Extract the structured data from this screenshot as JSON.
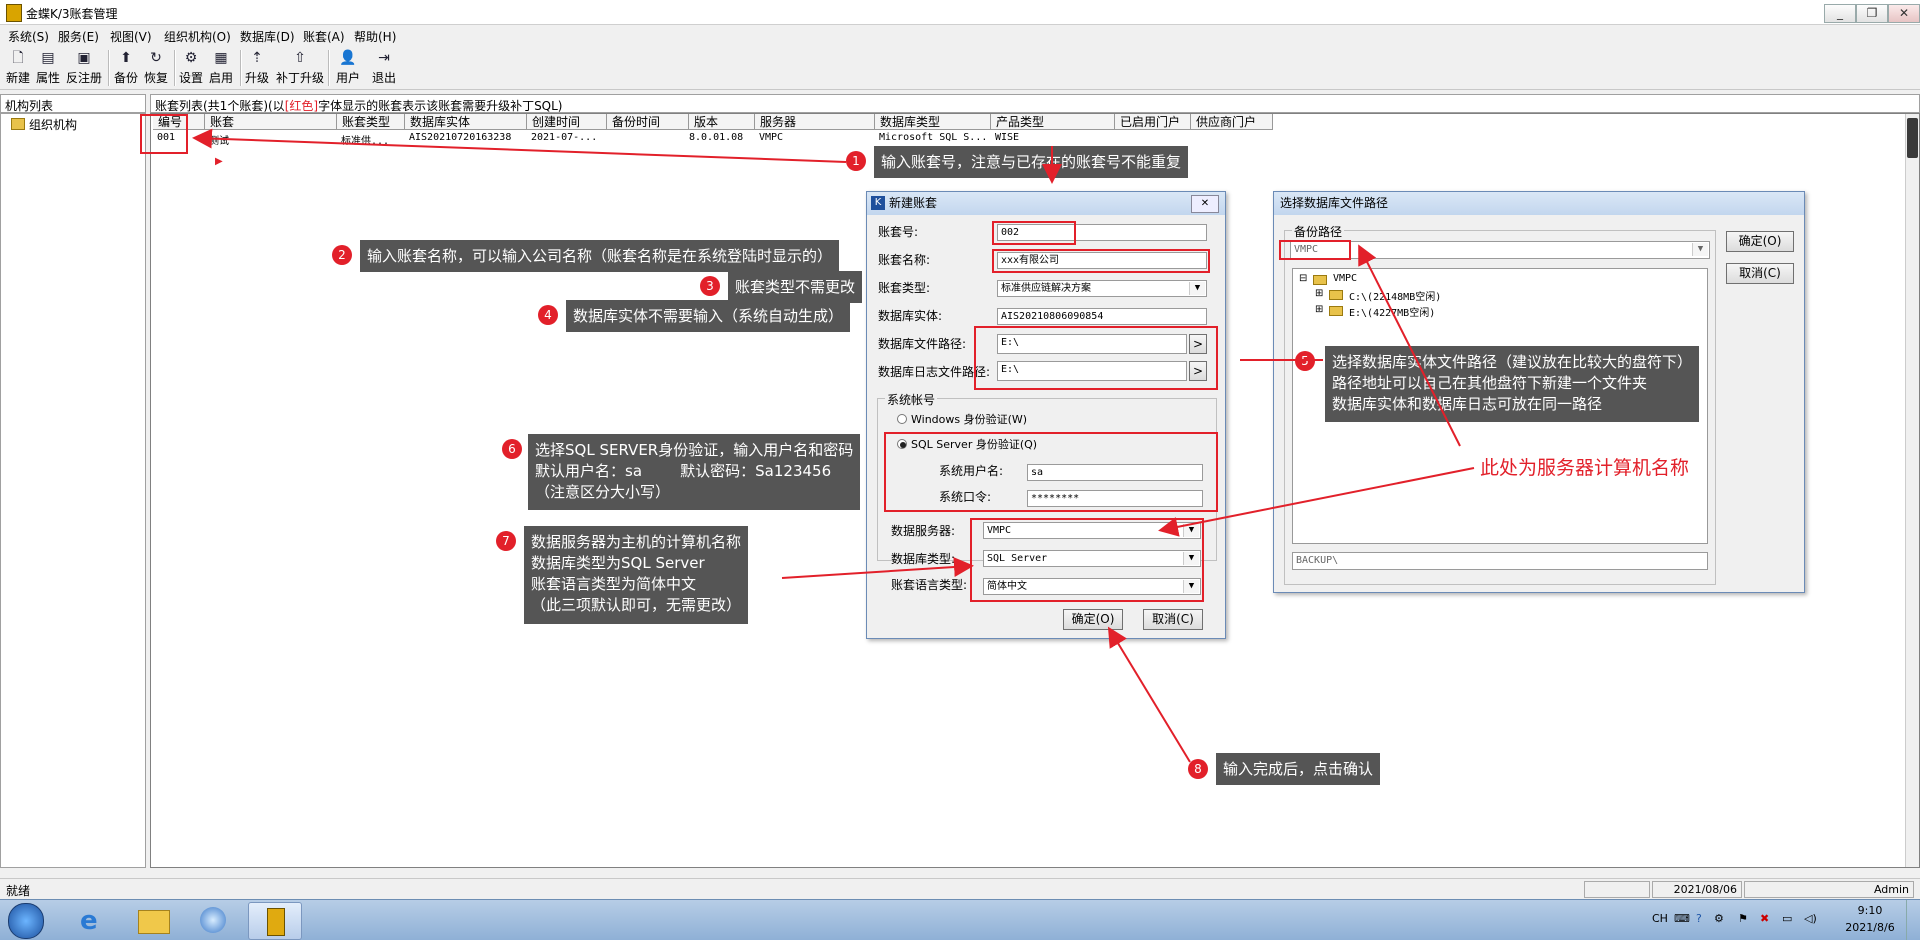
{
  "window": {
    "title": "金蝶K/3账套管理"
  },
  "menu": [
    "系统(S)",
    "服务(E)",
    "视图(V)",
    "组织机构(O)",
    "数据库(D)",
    "账套(A)",
    "帮助(H)"
  ],
  "toolbar": [
    "新建",
    "属性",
    "反注册",
    "备份",
    "恢复",
    "设置",
    "启用",
    "升级",
    "补丁升级",
    "用户",
    "退出"
  ],
  "left_panel": {
    "header": "机构列表",
    "tree_root": "组织机构"
  },
  "account_list": {
    "header": "账套列表(共1个账套)(以",
    "header_red": "[红色]",
    "header_tail": "字体显示的账套表示该账套需要升级补丁SQL)",
    "columns": [
      "编号",
      "账套",
      "账套类型",
      "数据库实体",
      "创建时间",
      "备份时间",
      "版本",
      "服务器",
      "数据库类型",
      "产品类型",
      "已启用门户",
      "供应商门户"
    ],
    "rows": [
      [
        "001",
        "测试",
        "标准供...",
        "AIS20210720163238",
        "2021-07-...",
        "",
        "8.0.01.08",
        "VMPC",
        "Microsoft SQL S...",
        "WISE",
        "",
        ""
      ]
    ]
  },
  "new_account_dialog": {
    "title": "新建账套",
    "fields": {
      "account_no": {
        "label": "账套号:",
        "value": "002"
      },
      "account_name": {
        "label": "账套名称:",
        "value": "xxx有限公司"
      },
      "account_type": {
        "label": "账套类型:",
        "value": "标准供应链解决方案"
      },
      "db_entity": {
        "label": "数据库实体:",
        "value": "AIS20210806090854"
      },
      "db_file_path": {
        "label": "数据库文件路径:",
        "value": "E:\\"
      },
      "db_log_path": {
        "label": "数据库日志文件路径:",
        "value": "E:\\"
      }
    },
    "system_account": {
      "group_label": "系统帐号",
      "windows_auth": "Windows 身份验证(W)",
      "sql_auth": "SQL Server 身份验证(Q)",
      "user_label": "系统用户名:",
      "user_value": "sa",
      "password_label": "系统口令:",
      "password_value": "********"
    },
    "db_server": {
      "label": "数据服务器:",
      "value": "VMPC"
    },
    "db_type": {
      "label": "数据库类型:",
      "value": "SQL Server"
    },
    "lang_type": {
      "label": "账套语言类型:",
      "value": "简体中文"
    },
    "ok": "确定(O)",
    "cancel": "取消(C)"
  },
  "path_dialog": {
    "title": "选择数据库文件路径",
    "group_label": "备份路径",
    "combo_value": "VMPC",
    "tree_root": "VMPC",
    "drives": [
      "C:\\(22148MB空闲)",
      "E:\\(4227MB空闲)"
    ],
    "path_field": "BACKUP\\",
    "ok": "确定(O)",
    "cancel": "取消(C)"
  },
  "callouts": {
    "c1": {
      "num": "1",
      "text": "输入账套号，注意与已存在的账套号不能重复"
    },
    "c2": {
      "num": "2",
      "text": "输入账套名称，可以输入公司名称（账套名称是在系统登陆时显示的）"
    },
    "c3": {
      "num": "3",
      "text": "账套类型不需更改"
    },
    "c4": {
      "num": "4",
      "text": "数据库实体不需要输入（系统自动生成）"
    },
    "c5": {
      "num": "5",
      "lines": [
        "选择数据库实体文件路径（建议放在比较大的盘符下）",
        "路径地址可以自己在其他盘符下新建一个文件夹",
        "数据库实体和数据库日志可放在同一路径"
      ]
    },
    "c6": {
      "num": "6",
      "lines": [
        "选择SQL SERVER身份验证，输入用户名和密码",
        "默认用户名：sa        默认密码：Sa123456",
        "（注意区分大小写）"
      ]
    },
    "c7": {
      "num": "7",
      "lines": [
        "数据服务器为主机的计算机名称",
        "数据库类型为SQL Server",
        "账套语言类型为简体中文",
        "（此三项默认即可，无需更改）"
      ]
    },
    "c8": {
      "num": "8",
      "text": "输入完成后，点击确认"
    },
    "server_note": "此处为服务器计算机名称"
  },
  "status": {
    "left": "就绪",
    "date": "2021/08/06",
    "user": "Admin"
  },
  "tray": {
    "lang": "CH",
    "time": "9:10",
    "date": "2021/8/6"
  }
}
